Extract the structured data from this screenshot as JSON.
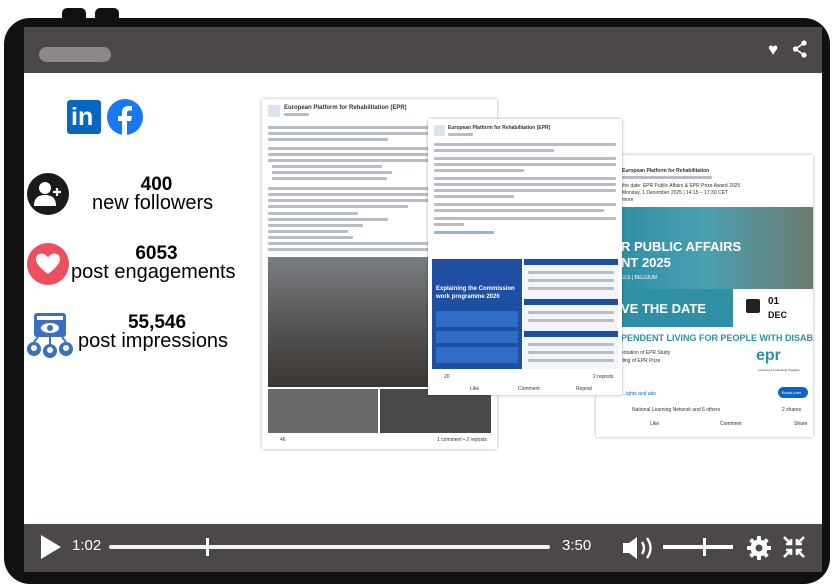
{
  "player": {
    "current_time": "1:02",
    "duration": "3:50",
    "progress": 0.22,
    "volume": 0.6
  },
  "social": {
    "linkedin_icon": "linkedin-icon",
    "facebook_icon": "facebook-icon",
    "linkedin_text": "in"
  },
  "stats": [
    {
      "value": "400",
      "label": "new followers",
      "icon": "add-user-icon"
    },
    {
      "value": "6053",
      "label": "post engagements",
      "icon": "heart-icon"
    },
    {
      "value": "55,546",
      "label": "post impressions",
      "icon": "impressions-icon"
    }
  ],
  "post1": {
    "org": "European Platform for Rehabilitation (EPR)",
    "reactions": "46",
    "comments": "1 comment • 2 reposts"
  },
  "post2": {
    "org": "European Platform for Rehabilitation (EPR)",
    "intro": "EPR welcomes the 2026 Work Programme of the European Commission and its inclusion of an updated disability strategy!",
    "banner_title": "Explaining the Commission work programme 2026",
    "reactions": "20",
    "reposts": "2 reposts",
    "actions": [
      "Like",
      "Comment",
      "Repost"
    ]
  },
  "post3": {
    "org": "European Platform for Rehabilitation",
    "line1": "the date: EPR Public Affairs & EPR Prize Award 2025",
    "line2": "Monday, 1 December 2025 | 14:15 – 17:30 CET",
    "more": "more",
    "banner_title": "R PUBLIC AFFAIRS",
    "banner_title2": "NT 2025",
    "save_date": "VE THE DATE",
    "day": "01",
    "month": "DEC",
    "tagline": "PENDENT LIVING FOR PEOPLE WITH DISABILITIES",
    "sub1": "entation of EPR Study",
    "sub2": "ding of EPR Prize",
    "logo": "epr",
    "logo_sub": "Learning & Innovating Together",
    "insights": "...ights and ads",
    "boost": "Boost post",
    "network": "National Learning Network and 6 others",
    "shares": "2 shares",
    "actions": [
      "Like",
      "Comment",
      "Share"
    ],
    "city": "ELS | BELGIUM"
  }
}
